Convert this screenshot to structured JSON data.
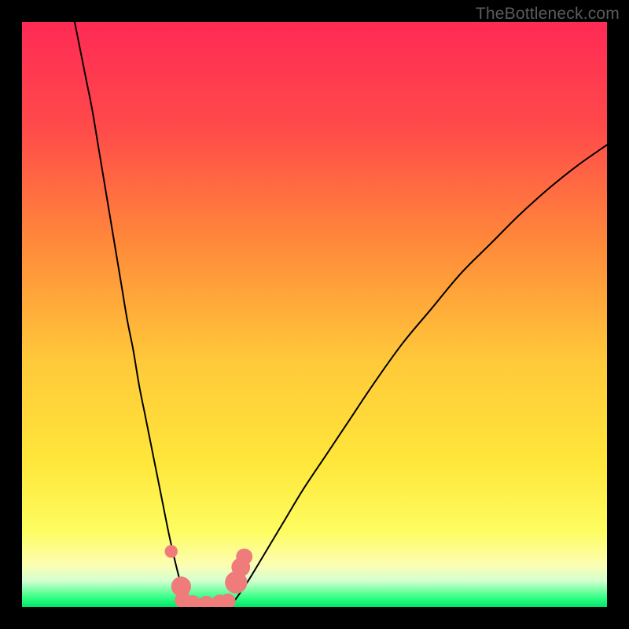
{
  "watermark": "TheBottleneck.com",
  "chart_data": {
    "type": "line",
    "title": "",
    "xlabel": "",
    "ylabel": "",
    "xlim": [
      0,
      100
    ],
    "ylim": [
      0,
      100
    ],
    "background_gradient_stops": [
      {
        "offset": 0.0,
        "color": "#ff2a55"
      },
      {
        "offset": 0.18,
        "color": "#ff4a4a"
      },
      {
        "offset": 0.38,
        "color": "#ff8a3a"
      },
      {
        "offset": 0.58,
        "color": "#ffc93a"
      },
      {
        "offset": 0.75,
        "color": "#ffe63a"
      },
      {
        "offset": 0.87,
        "color": "#fdfd60"
      },
      {
        "offset": 0.928,
        "color": "#fdfdb3"
      },
      {
        "offset": 0.955,
        "color": "#d5ffd0"
      },
      {
        "offset": 0.985,
        "color": "#2fff82"
      },
      {
        "offset": 1.0,
        "color": "#00e56a"
      }
    ],
    "series": [
      {
        "name": "left-branch",
        "x": [
          9,
          10,
          11,
          12,
          13,
          14,
          15,
          16,
          17,
          18,
          19,
          20,
          21,
          22,
          23,
          24,
          25,
          26,
          27,
          28,
          28.5
        ],
        "values": [
          100,
          95,
          90,
          85,
          79,
          73,
          67,
          61,
          55,
          49,
          44,
          38,
          33,
          28,
          23,
          18,
          13,
          8.5,
          4.5,
          1.2,
          0
        ]
      },
      {
        "name": "valley-floor",
        "x": [
          28.5,
          29,
          30,
          31,
          32,
          33,
          34,
          35,
          35.5
        ],
        "values": [
          0,
          0,
          0,
          0,
          0,
          0,
          0,
          0,
          0
        ]
      },
      {
        "name": "right-branch",
        "x": [
          35.5,
          37,
          39,
          42,
          45,
          48,
          52,
          56,
          60,
          65,
          70,
          75,
          80,
          85,
          90,
          95,
          100
        ],
        "values": [
          0,
          2,
          5,
          10,
          15,
          20,
          26,
          32,
          38,
          45,
          51,
          57,
          62,
          67,
          71.5,
          75.5,
          79
        ]
      }
    ],
    "markers": [
      {
        "x": 25.5,
        "y": 9.5,
        "r": 1.1
      },
      {
        "x": 27.2,
        "y": 3.5,
        "r": 1.7
      },
      {
        "x": 27.5,
        "y": 1.2,
        "r": 1.4
      },
      {
        "x": 29.2,
        "y": 0.6,
        "r": 1.4
      },
      {
        "x": 31.5,
        "y": 0.5,
        "r": 1.4
      },
      {
        "x": 33.8,
        "y": 0.6,
        "r": 1.5
      },
      {
        "x": 35.2,
        "y": 1.0,
        "r": 1.3
      },
      {
        "x": 36.6,
        "y": 4.2,
        "r": 1.9
      },
      {
        "x": 37.4,
        "y": 6.8,
        "r": 1.6
      },
      {
        "x": 38.0,
        "y": 8.6,
        "r": 1.4
      }
    ],
    "marker_color": "#ef7b7b"
  }
}
